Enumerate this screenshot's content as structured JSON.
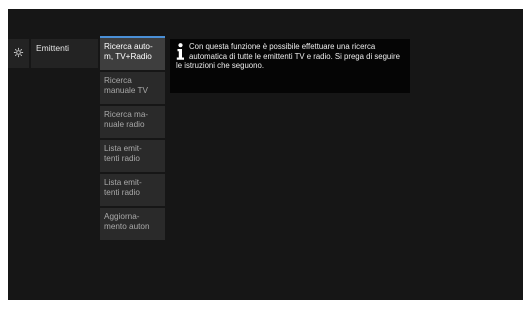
{
  "sidebar": {
    "settings_icon": "gear-icon",
    "category_label": "Emittenti"
  },
  "submenu": {
    "items": [
      {
        "label": "Ricerca auto-\nm, TV+Radio",
        "selected": true
      },
      {
        "label": "Ricerca\nmanuale TV",
        "selected": false
      },
      {
        "label": "Ricerca ma-\nnuale radio",
        "selected": false
      },
      {
        "label": "Lista emit-\ntenti radio",
        "selected": false
      },
      {
        "label": "Lista emit-\ntenti radio",
        "selected": false
      },
      {
        "label": "Aggiorna-\nmento auton",
        "selected": false
      }
    ]
  },
  "info": {
    "icon": "info-icon",
    "text": "Con questa funzione è possibile effettuare una ricerca automatica di tutte le emittenti TV e radio. Si prega di seguire le istruzioni che seguono."
  },
  "colors": {
    "screen_bg": "#161616",
    "tile_bg": "#232323",
    "selected_bg": "#3e3e3e",
    "accent": "#4a8fd6",
    "info_bg": "#050505"
  }
}
